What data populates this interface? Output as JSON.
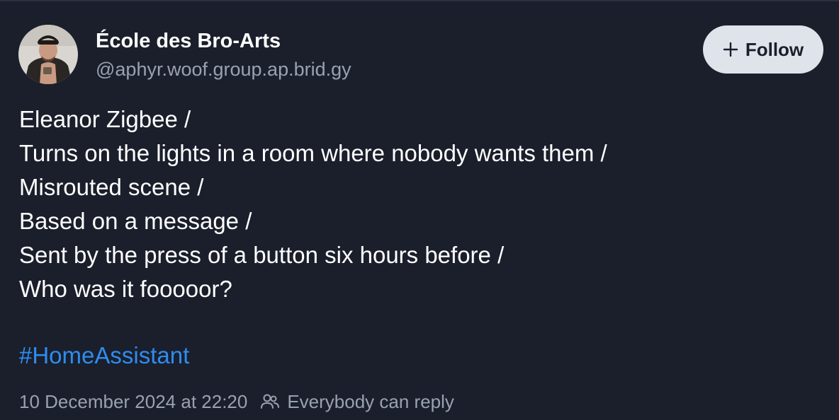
{
  "author": {
    "display_name": "École des Bro-Arts",
    "handle": "@aphyr.woof.group.ap.brid.gy"
  },
  "follow_button": {
    "label": "Follow",
    "icon": "plus-icon"
  },
  "post": {
    "lines": [
      "Eleanor Zigbee /",
      "Turns on the lights in a room where nobody wants them /",
      "Misrouted scene /",
      "Based on a message /",
      "Sent by the press of a button six hours before /",
      "Who was it fooooor?"
    ],
    "hashtag": "#HomeAssistant"
  },
  "meta": {
    "timestamp": "10 December 2024 at 22:20",
    "reply_setting": "Everybody can reply",
    "reply_icon": "people-icon"
  },
  "colors": {
    "background": "#1a1f2b",
    "hashtag": "#2f8cf0",
    "muted_text": "#9aa1b1",
    "follow_button_bg": "#dfe3ea"
  }
}
